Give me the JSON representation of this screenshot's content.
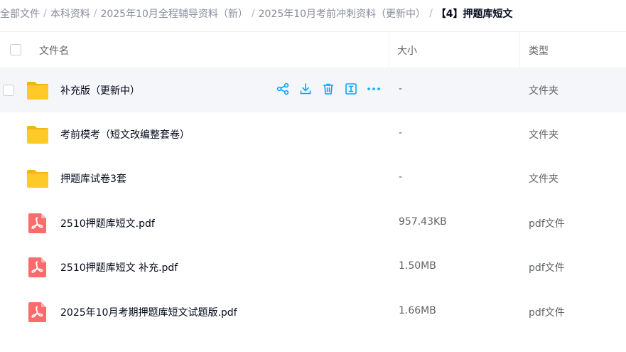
{
  "breadcrumb": [
    {
      "label": "全部文件"
    },
    {
      "label": "本科资料"
    },
    {
      "label": "2025年10月全程辅导资料（新）"
    },
    {
      "label": "2025年10月考前冲刺资料（更新中）"
    },
    {
      "label": "【4】押题库短文"
    }
  ],
  "breadcrumb_separator": "/",
  "header": {
    "name": "文件名",
    "size": "大小",
    "type": "类型"
  },
  "accent_color": "#06a7ff",
  "rows": [
    {
      "name": "补充版（更新中）",
      "size": "-",
      "type": "文件夹",
      "icon": "folder-icon"
    },
    {
      "name": "考前模考（短文改编整套卷）",
      "size": "-",
      "type": "文件夹",
      "icon": "folder-icon"
    },
    {
      "name": "押题库试卷3套",
      "size": "-",
      "type": "文件夹",
      "icon": "folder-icon"
    },
    {
      "name": "2510押题库短文.pdf",
      "size": "957.43KB",
      "type": "pdf文件",
      "icon": "pdf-icon"
    },
    {
      "name": "2510押题库短文 补充.pdf",
      "size": "1.50MB",
      "type": "pdf文件",
      "icon": "pdf-icon"
    },
    {
      "name": "2025年10月考期押题库短文试题版.pdf",
      "size": "1.66MB",
      "type": "pdf文件",
      "icon": "pdf-icon"
    }
  ],
  "row_actions": [
    "share-icon",
    "download-icon",
    "delete-icon",
    "rename-icon",
    "more-icon"
  ]
}
